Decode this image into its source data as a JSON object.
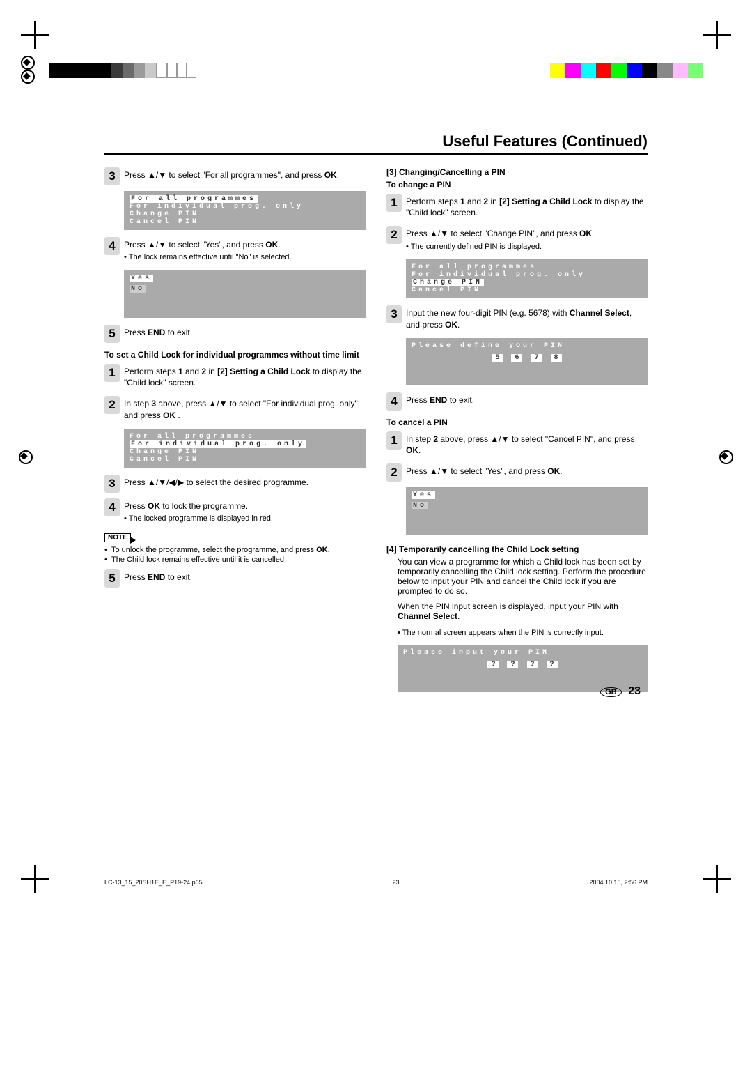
{
  "section_title": "Useful Features (Continued)",
  "left": {
    "s3": {
      "text": "Press ▲/▼ to select \"For all programmes\", and press ",
      "ok": "OK",
      "tail": "."
    },
    "osd1": {
      "l1": "For all programmes",
      "l2": "For individual prog. only",
      "l3": "Change PIN",
      "l4": "Cancel PIN"
    },
    "s4": {
      "text": "Press ▲/▼ to select \"Yes\", and press ",
      "ok": "OK",
      "tail": ".",
      "sub": "The lock remains effective until \"No\" is selected."
    },
    "osd2": {
      "yes": "Yes",
      "no": "No"
    },
    "s5": {
      "a": "Press ",
      "b": "END",
      "c": " to exit."
    },
    "h1": "To set a Child Lock for individual programmes without time limit",
    "i1": {
      "a": "Perform steps ",
      "b1": "1",
      "c": " and ",
      "b2": "2",
      "d": " in ",
      "e": "[2] Setting a Child Lock",
      "f": " to display the \"Child lock\" screen."
    },
    "i2": {
      "a": "In step ",
      "b": "3",
      "c": " above, press ▲/▼ to select \"For individual prog. only\", and press ",
      "ok": "OK",
      "tail": " ."
    },
    "osd3": {
      "l1": "For all programmes",
      "l2": "For individual prog. only",
      "l3": "Change PIN",
      "l4": "Cancel PIN"
    },
    "i3": "Press ▲/▼/◀/▶ to select the desired programme.",
    "i4": {
      "a": "Press ",
      "ok": "OK",
      "b": " to lock the programme.",
      "sub": "The locked programme is displayed in red."
    },
    "note_label": "NOTE",
    "note1": "To unlock the programme, select the programme, and press ",
    "note1b": "OK",
    "note1c": ".",
    "note2": "The Child lock remains effective until it is cancelled.",
    "i5": {
      "a": "Press ",
      "b": "END",
      "c": " to exit."
    }
  },
  "right": {
    "h3": "[3] Changing/Cancelling a PIN",
    "sub_change": "To change a PIN",
    "c1": {
      "a": "Perform steps ",
      "b1": "1",
      "c": " and ",
      "b2": "2",
      "d": " in ",
      "e": "[2] Setting a Child Lock",
      "f": " to display the \"Child lock\" screen."
    },
    "c2": {
      "a": "Press ▲/▼ to select \"Change PIN\", and press ",
      "ok": "OK",
      "tail": ".",
      "sub": "The currently defined PIN is displayed."
    },
    "osd4": {
      "l1": "For all programmes",
      "l2": "For individual prog. only",
      "l3": "Change PIN",
      "l4": "Cancel PIN"
    },
    "c3": {
      "a": "Input the new four-digit PIN (e.g. 5678) with ",
      "b": "Channel Select",
      "c": ", and press ",
      "ok": "OK",
      "tail": "."
    },
    "osd5": {
      "title": "Please define your PIN",
      "d1": "5",
      "d2": "6",
      "d3": "7",
      "d4": "8"
    },
    "c4": {
      "a": "Press ",
      "b": "END",
      "c": " to exit."
    },
    "sub_cancel": "To cancel a PIN",
    "x1": {
      "a": "In step ",
      "b": "2",
      "c": " above, press ▲/▼ to select \"Cancel PIN\", and press ",
      "ok": "OK",
      "tail": "."
    },
    "x2": {
      "a": "Press ▲/▼ to select \"Yes\", and press ",
      "ok": "OK",
      "tail": "."
    },
    "osd6": {
      "yes": "Yes",
      "no": "No"
    },
    "h4": "[4] Temporarily cancelling the Child Lock setting",
    "p4a": "You can view a programme for which a Child lock has been set by temporarily cancelling the Child lock setting. Perform the procedure below to input your PIN and cancel the Child lock if you are prompted to do so.",
    "p4b_a": "When the PIN input screen is displayed, input your PIN with ",
    "p4b_b": "Channel Select",
    "p4b_c": ".",
    "p4_sub": "The normal screen appears when the PIN is correctly input.",
    "osd7": {
      "title": "Please input your PIN",
      "q": "?"
    }
  },
  "footer": {
    "file": "LC-13_15_20SH1E_E_P19-24.p65",
    "page": "23",
    "date": "2004.10.15, 2:56 PM",
    "gb": "GB",
    "pageno": "23"
  }
}
